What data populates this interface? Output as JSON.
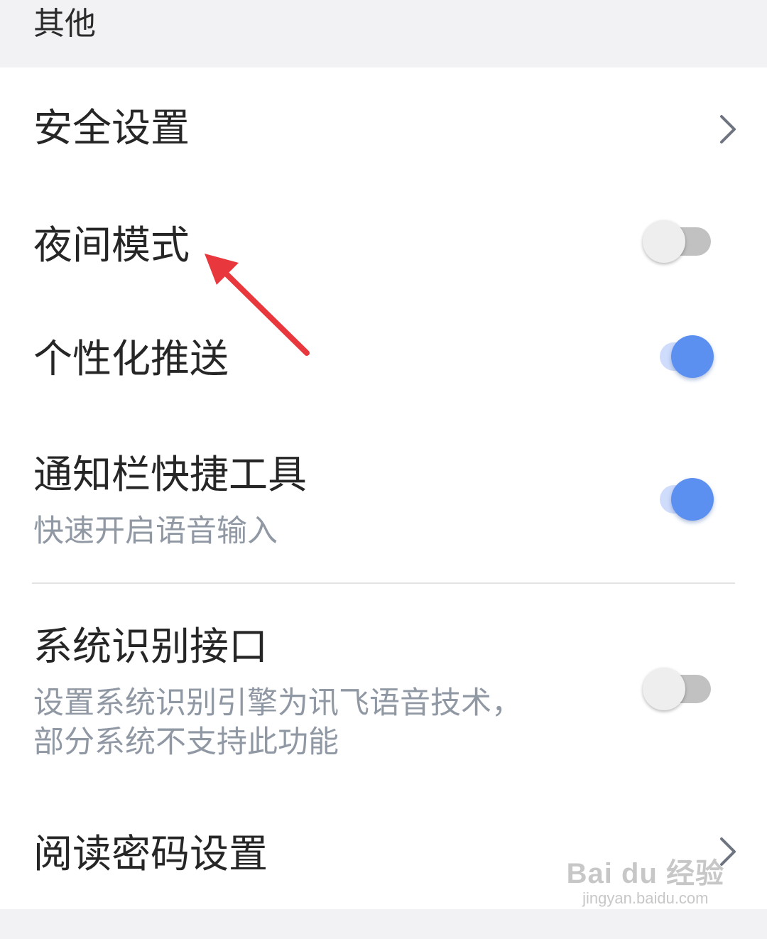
{
  "section": {
    "title": "其他"
  },
  "settings": [
    {
      "title": "安全设置",
      "control": "chevron"
    },
    {
      "title": "夜间模式",
      "control": "toggle",
      "state": "off"
    },
    {
      "title": "个性化推送",
      "control": "toggle",
      "state": "on"
    },
    {
      "title": "通知栏快捷工具",
      "subtitle": "快速开启语音输入",
      "control": "toggle",
      "state": "on"
    },
    {
      "title": "系统识别接口",
      "subtitle_lines": [
        "设置系统识别引擎为讯飞语音技术，",
        "部分系统不支持此功能"
      ],
      "control": "toggle",
      "state": "off"
    },
    {
      "title": "阅读密码设置",
      "control": "chevron"
    }
  ],
  "colors": {
    "toggle_on": "#5b8ff0",
    "toggle_on_track": "#cfdcfb",
    "toggle_off_track": "#c1c1c1",
    "annotation_arrow": "#e8383d"
  },
  "icons": {
    "chevron": "chevron-right-icon",
    "annotation": "red-arrow-icon"
  }
}
